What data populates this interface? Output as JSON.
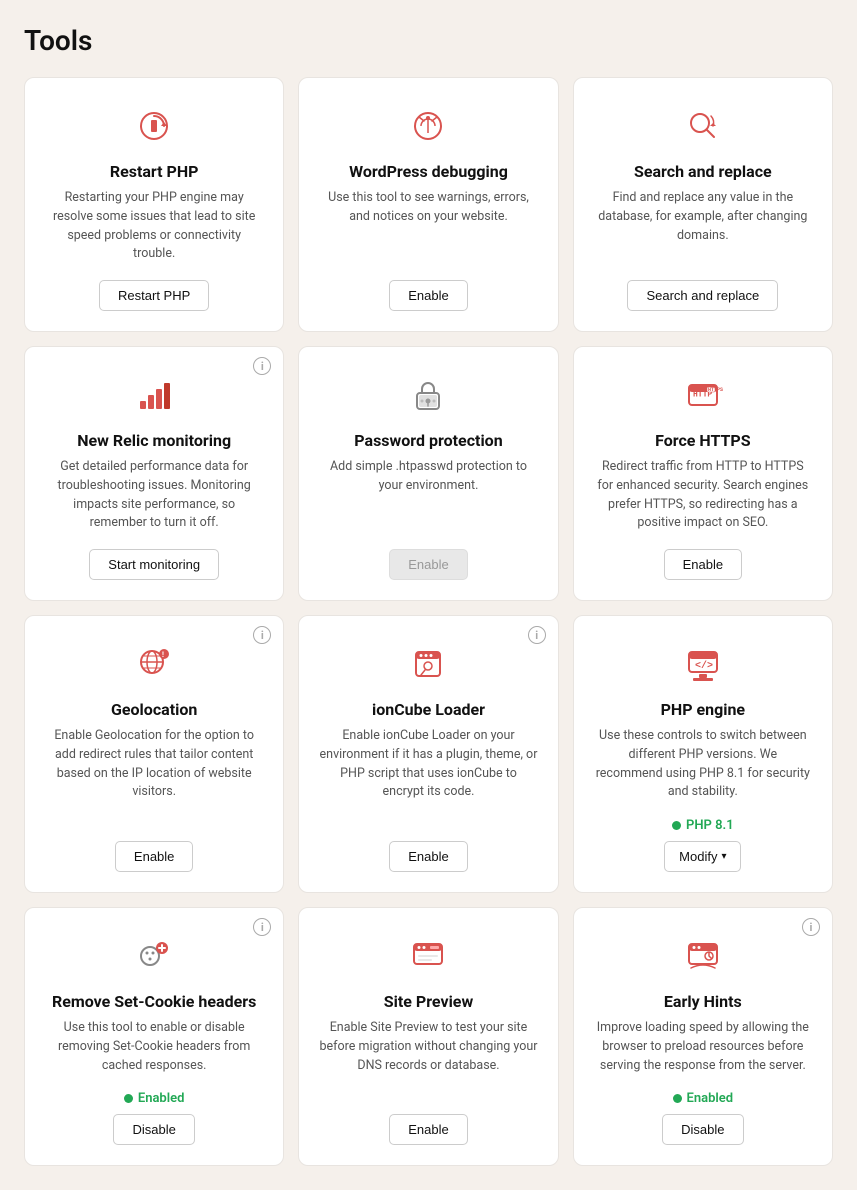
{
  "page": {
    "title": "Tools"
  },
  "cards": [
    {
      "id": "restart-php",
      "title": "Restart PHP",
      "desc": "Restarting your PHP engine may resolve some issues that lead to site speed problems or connectivity trouble.",
      "icon": "restart-php-icon",
      "actions": [
        {
          "label": "Restart PHP",
          "type": "button",
          "disabled": false
        }
      ],
      "has_info": false
    },
    {
      "id": "wordpress-debugging",
      "title": "WordPress debugging",
      "desc": "Use this tool to see warnings, errors, and notices on your website.",
      "icon": "wordpress-debug-icon",
      "actions": [
        {
          "label": "Enable",
          "type": "button",
          "disabled": false
        }
      ],
      "has_info": false
    },
    {
      "id": "search-and-replace",
      "title": "Search and replace",
      "desc": "Find and replace any value in the database, for example, after changing domains.",
      "icon": "search-replace-icon",
      "actions": [
        {
          "label": "Search and replace",
          "type": "button",
          "disabled": false
        }
      ],
      "has_info": false
    },
    {
      "id": "new-relic-monitoring",
      "title": "New Relic monitoring",
      "desc": "Get detailed performance data for troubleshooting issues. Monitoring impacts site performance, so remember to turn it off.",
      "icon": "new-relic-icon",
      "actions": [
        {
          "label": "Start monitoring",
          "type": "button",
          "disabled": false
        }
      ],
      "has_info": true
    },
    {
      "id": "password-protection",
      "title": "Password protection",
      "desc": "Add simple .htpasswd protection to your environment.",
      "icon": "password-protection-icon",
      "actions": [
        {
          "label": "Enable",
          "type": "button",
          "disabled": true
        }
      ],
      "has_info": false
    },
    {
      "id": "force-https",
      "title": "Force HTTPS",
      "desc": "Redirect traffic from HTTP to HTTPS for enhanced security. Search engines prefer HTTPS, so redirecting has a positive impact on SEO.",
      "icon": "force-https-icon",
      "actions": [
        {
          "label": "Enable",
          "type": "button",
          "disabled": false
        }
      ],
      "has_info": false
    },
    {
      "id": "geolocation",
      "title": "Geolocation",
      "desc": "Enable Geolocation for the option to add redirect rules that tailor content based on the IP location of website visitors.",
      "icon": "geolocation-icon",
      "actions": [
        {
          "label": "Enable",
          "type": "button",
          "disabled": false
        }
      ],
      "has_info": true
    },
    {
      "id": "ioncube-loader",
      "title": "ionCube Loader",
      "desc": "Enable ionCube Loader on your environment if it has a plugin, theme, or PHP script that uses ionCube to encrypt its code.",
      "icon": "ioncube-icon",
      "actions": [
        {
          "label": "Enable",
          "type": "button",
          "disabled": false
        }
      ],
      "has_info": true
    },
    {
      "id": "php-engine",
      "title": "PHP engine",
      "desc": "Use these controls to switch between different PHP versions. We recommend using PHP 8.1 for security and stability.",
      "icon": "php-engine-icon",
      "actions": [
        {
          "type": "status",
          "label": "PHP 8.1"
        },
        {
          "label": "Modify",
          "type": "dropdown",
          "disabled": false
        }
      ],
      "has_info": false
    },
    {
      "id": "remove-set-cookie",
      "title": "Remove Set-Cookie headers",
      "desc": "Use this tool to enable or disable removing Set-Cookie headers from cached responses.",
      "icon": "remove-cookie-icon",
      "actions": [
        {
          "type": "status",
          "label": "Enabled"
        },
        {
          "label": "Disable",
          "type": "button",
          "disabled": false
        }
      ],
      "has_info": true
    },
    {
      "id": "site-preview",
      "title": "Site Preview",
      "desc": "Enable Site Preview to test your site before migration without changing your DNS records or database.",
      "icon": "site-preview-icon",
      "actions": [
        {
          "label": "Enable",
          "type": "button",
          "disabled": false
        }
      ],
      "has_info": false
    },
    {
      "id": "early-hints",
      "title": "Early Hints",
      "desc": "Improve loading speed by allowing the browser to preload resources before serving the response from the server.",
      "icon": "early-hints-icon",
      "actions": [
        {
          "type": "status",
          "label": "Enabled"
        },
        {
          "label": "Disable",
          "type": "button",
          "disabled": false
        }
      ],
      "has_info": true
    }
  ]
}
